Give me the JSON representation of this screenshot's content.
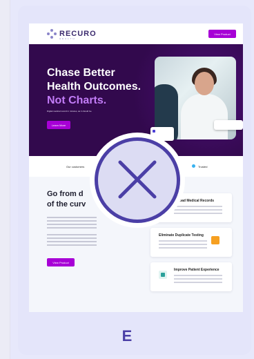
{
  "site": {
    "logo": {
      "brand": "RECURO",
      "sub": "HEALTH"
    },
    "topbar": {
      "button_label": "View Product"
    },
    "hero": {
      "headline_line1": "Chase Better",
      "headline_line2": "Health Outcomes.",
      "headline_accent": "Not Charts.",
      "tagline": "Digital medical record in minutes, as it should be.",
      "cta_label": "Learn More"
    },
    "strip": {
      "left_text": "Our customers",
      "right_text": "Trusted"
    },
    "lower": {
      "heading_line1": "Go from d",
      "heading_line2": "of the curv",
      "cta_label": "View Product"
    },
    "features": [
      {
        "title": "Upload Medical Records",
        "icon": "upload-icon"
      },
      {
        "title": "Eliminate Duplicate Testing",
        "icon": "duplicate-icon"
      },
      {
        "title": "Improve Patient Experience",
        "icon": "patient-icon"
      }
    ]
  },
  "overlay": {
    "icon": "close-icon",
    "state": "rejected"
  },
  "option_label": "E",
  "colors": {
    "accent": "#a700d6",
    "hero_bg": "#32094d",
    "overlay_ring": "#4b3fa6",
    "card_bg": "#e4e5fa"
  }
}
